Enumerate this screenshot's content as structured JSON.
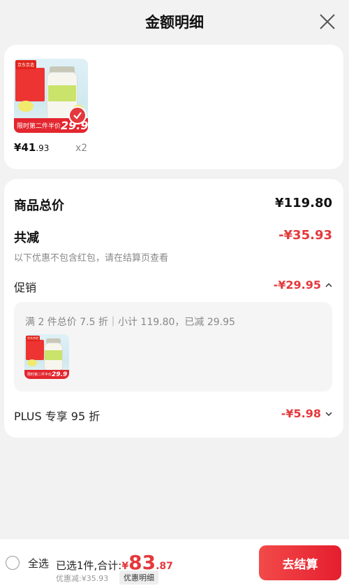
{
  "header": {
    "title": "金额明细"
  },
  "items": [
    {
      "thumb": {
        "brand_tag": "京东京造",
        "promo_text": "限时第二件半价",
        "promo_price": "29.9"
      },
      "price_symbol": "¥",
      "price_int": "41",
      "price_dec": ".93",
      "quantity": "x2",
      "selected": true
    }
  ],
  "summary": {
    "total_label": "商品总价",
    "total_value": "¥119.80",
    "discount_label": "共减",
    "discount_value": "-¥35.93",
    "discount_note": "以下优惠不包含红包，请在结算页查看"
  },
  "promotion": {
    "label": "促销",
    "value": "-¥29.95",
    "description": "满 2 件总价 7.5 折｜小计 119.80，已减 29.95",
    "thumb": {
      "brand_tag": "京东京造",
      "promo_text": "限时第二件半价",
      "promo_price": "29.9"
    }
  },
  "plus": {
    "label": "PLUS 专享 95 折",
    "value": "-¥5.98"
  },
  "footer": {
    "select_all_label": "全选",
    "selected_text": "已选1件,合计:",
    "sum_currency": "¥",
    "sum_int": "83",
    "sum_dec": ".87",
    "saved_text": "优惠减:¥35.93",
    "detail_label": "优惠明细",
    "checkout_label": "去结算"
  },
  "colors": {
    "accent": "#e4393c",
    "background": "#f2f2f2"
  },
  "icons": {
    "close": "close-icon",
    "check": "check-icon",
    "chevron_up": "chevron-up-icon",
    "chevron_down": "chevron-down-icon"
  }
}
